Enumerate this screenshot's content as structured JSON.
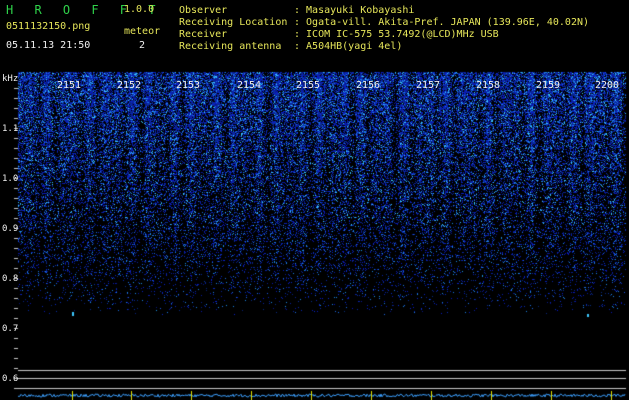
{
  "app": {
    "title": "H R O F F T",
    "version": "1.0.0",
    "filename": "0511132150.png",
    "datetime": "05.11.13 21:50",
    "meteor_label": "meteor",
    "meteor_count": "2"
  },
  "info": {
    "observer_label": "Observer",
    "observer_value": ": Masayuki Kobayashi",
    "location_label": "Receiving Location",
    "location_value": ": Ogata-vill. Akita-Pref. JAPAN (139.96E, 40.02N)",
    "receiver_label": "Receiver",
    "receiver_value": ": ICOM IC-575 53.7492(@LCD)MHz USB",
    "antenna_label": "Receiving antenna",
    "antenna_value": ": A504HB(yagi 4el)"
  },
  "spectrogram": {
    "unit_label": "kHz",
    "freq_ticks": [
      "1.1",
      "1.0",
      "0.9",
      "0.8",
      "0.7",
      "0.6"
    ],
    "minute_labels": [
      "2151",
      "2152",
      "2153",
      "2154",
      "2155",
      "2156",
      "2157",
      "2158",
      "2159",
      "2200"
    ],
    "colors": {
      "background": "#000000",
      "signal_low": "#0a1a8c",
      "signal_high": "#3cc8ff",
      "grid_lines": "#c8c8c8"
    }
  }
}
